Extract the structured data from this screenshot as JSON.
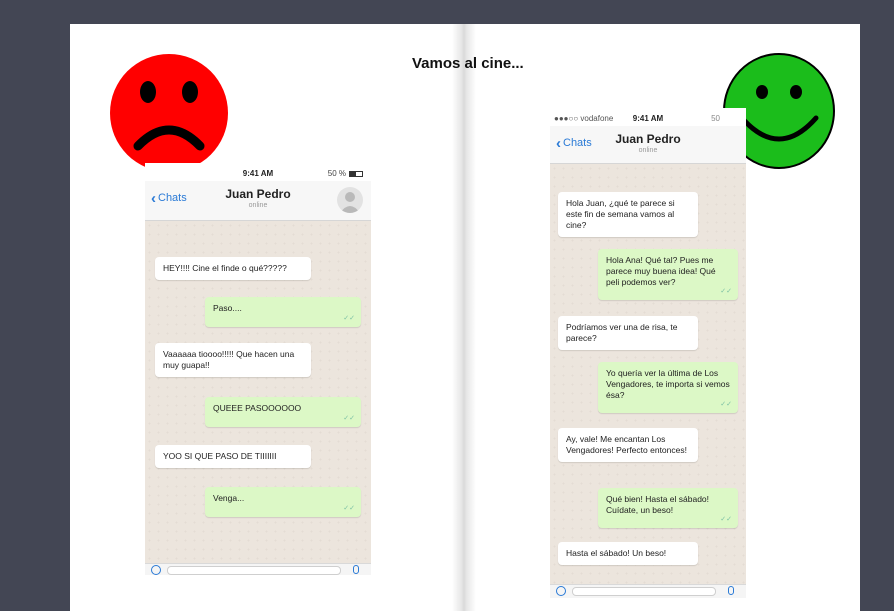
{
  "title": "Vamos al cine...",
  "colors": {
    "sad_face": "#ff0000",
    "happy_face": "#1bbd1b",
    "link": "#2a7ad6",
    "bubble_out": "#dcf8c6",
    "bubble_in": "#ffffff"
  },
  "left_phone": {
    "time": "9:41 AM",
    "battery": "50 %",
    "back_label": "Chats",
    "contact_name": "Juan Pedro",
    "contact_status": "online",
    "messages": [
      {
        "dir": "in",
        "text": "HEY!!!! Cine el finde o qué?????"
      },
      {
        "dir": "out",
        "text": "Paso...."
      },
      {
        "dir": "in",
        "text": "Vaaaaaa tioooo!!!!! Que hacen una muy guapa!!"
      },
      {
        "dir": "out",
        "text": "QUEEE PASOOOOOO"
      },
      {
        "dir": "in",
        "text": "YOO SI QUE PASO DE TIIIIIII"
      },
      {
        "dir": "out",
        "text": "Venga..."
      }
    ]
  },
  "right_phone": {
    "carrier": "●●●○○ vodafone",
    "time": "9:41 AM",
    "signal": "50",
    "back_label": "Chats",
    "contact_name": "Juan Pedro",
    "contact_status": "online",
    "messages": [
      {
        "dir": "in",
        "text": "Hola Juan, ¿qué te parece si este fin de semana vamos al cine?"
      },
      {
        "dir": "out",
        "text": "Hola Ana! Qué tal? Pues me parece muy buena idea! Qué peli podemos ver?"
      },
      {
        "dir": "in",
        "text": "Podríamos ver una de risa, te parece?"
      },
      {
        "dir": "out",
        "text": "Yo quería ver la última de Los Vengadores, te importa si vemos ésa?"
      },
      {
        "dir": "in",
        "text": "Ay, vale! Me encantan Los Vengadores! Perfecto entonces!"
      },
      {
        "dir": "out",
        "text": "Qué bien! Hasta el sábado! Cuídate, un beso!"
      },
      {
        "dir": "in",
        "text": "Hasta el sábado! Un beso!"
      }
    ]
  },
  "icons": {
    "sad": "sad-face-icon",
    "happy": "happy-face-icon",
    "back": "chevron-left-icon",
    "avatar": "contact-avatar-icon",
    "tick": "double-check-icon"
  }
}
